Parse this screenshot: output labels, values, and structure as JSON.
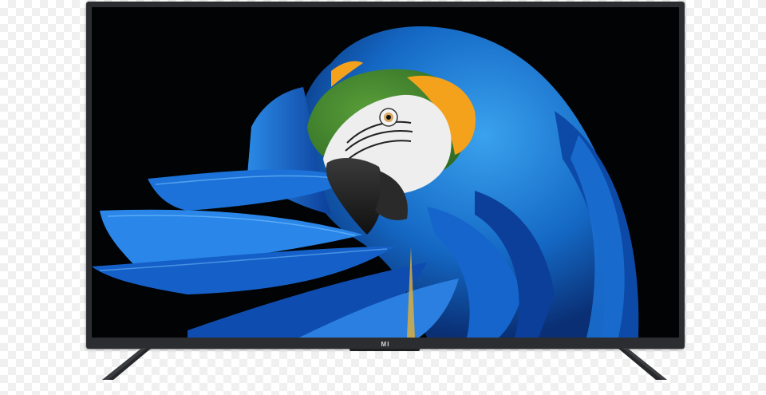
{
  "product": {
    "brand_logo": "MI",
    "image_subject": "macaw-parrot"
  },
  "colors": {
    "bezel": "#2b2d30",
    "screen_background": "#020304",
    "feather_blue": "#1e7fd6",
    "feather_dark": "#0a3c8c",
    "cheek_yellow": "#f4a21c",
    "head_green": "#4b8a2a",
    "face_white": "#eeeeee"
  }
}
